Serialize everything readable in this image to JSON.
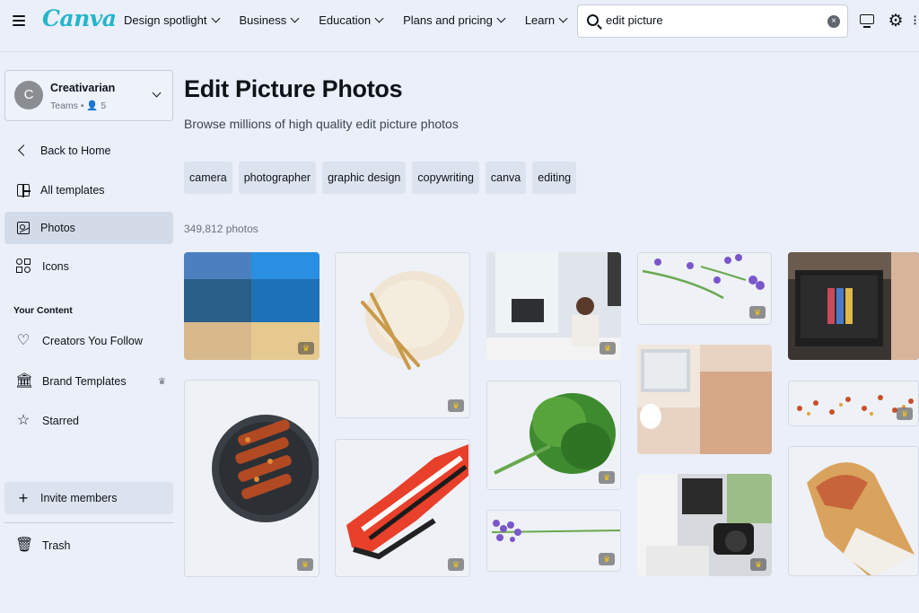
{
  "header": {
    "logo": "Canva",
    "nav": [
      {
        "label": "Design spotlight"
      },
      {
        "label": "Business"
      },
      {
        "label": "Education"
      },
      {
        "label": "Plans and pricing"
      },
      {
        "label": "Learn"
      }
    ],
    "search_value": "edit picture",
    "icons": [
      "menu-icon",
      "search-icon",
      "clear-icon",
      "desktop-icon",
      "gear-icon"
    ]
  },
  "sidebar": {
    "team": {
      "avatar_letter": "C",
      "name": "Creativarian",
      "meta": "Teams • 👤 5"
    },
    "items": [
      {
        "label": "Back to Home",
        "icon": "back-arrow-icon"
      },
      {
        "label": "All templates",
        "icon": "templates-icon"
      },
      {
        "label": "Photos",
        "icon": "photos-icon",
        "active": true
      },
      {
        "label": "Icons",
        "icon": "icons-icon"
      }
    ],
    "your_content_heading": "Your Content",
    "content_items": [
      {
        "label": "Creators You Follow",
        "icon": "heart-icon"
      },
      {
        "label": "Brand Templates",
        "icon": "brand-icon"
      },
      {
        "label": "Starred",
        "icon": "star-icon"
      }
    ],
    "invite_label": "Invite members",
    "trash_label": "Trash"
  },
  "main": {
    "title": "Edit Picture Photos",
    "subtitle": "Browse millions of high quality edit picture photos",
    "chips": [
      "camera",
      "photographer",
      "graphic design",
      "copywriting",
      "canva",
      "editing"
    ],
    "count": "349,812 photos",
    "photos": [
      {
        "name": "beach-before-after-photo",
        "accent": "#2b6fb0"
      },
      {
        "name": "grilled-skewers-photo",
        "accent": "#3a3f45"
      },
      {
        "name": "wheat-flour-photo",
        "accent": "#e9dfcc"
      },
      {
        "name": "red-sneaker-photo",
        "accent": "#e8402a"
      },
      {
        "name": "woman-at-computer-photo",
        "accent": "#cfd6dd"
      },
      {
        "name": "kale-photo",
        "accent": "#3e8a2f"
      },
      {
        "name": "lavender-sprig-photo",
        "accent": "#7a57c9"
      },
      {
        "name": "lavender-branch-photo",
        "accent": "#7a57c9"
      },
      {
        "name": "laptop-desk-photo",
        "accent": "#e8d3c3"
      },
      {
        "name": "camera-editing-desk-photo",
        "accent": "#b9c4b4"
      },
      {
        "name": "photo-editing-laptop-photo",
        "accent": "#3b3532"
      },
      {
        "name": "chili-flakes-photo",
        "accent": "#c8502a"
      },
      {
        "name": "wrap-sandwich-photo",
        "accent": "#d9a35d"
      }
    ]
  }
}
